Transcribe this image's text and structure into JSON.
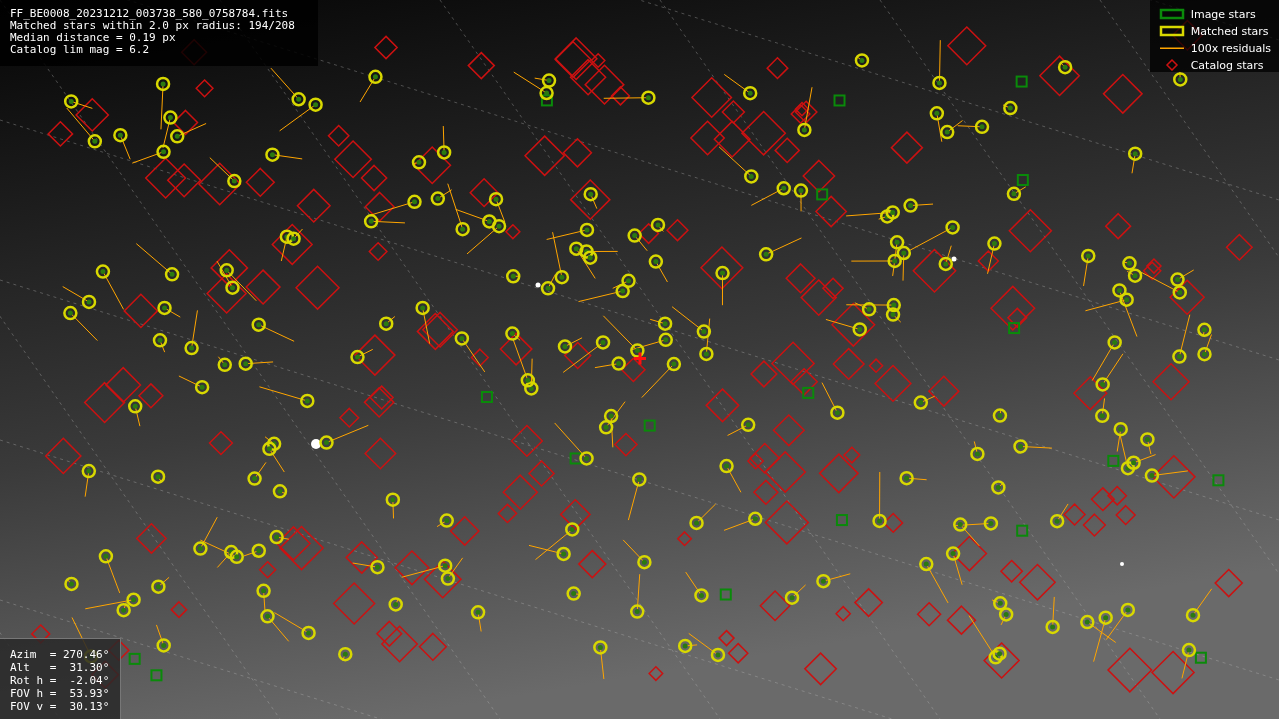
{
  "info_lines": [
    "FF_BE0008_20231212_003738_580_0758784.fits",
    "Matched stars within 2.0 px radius: 194/208",
    "Median distance = 0.19 px",
    "Catalog lim mag = 6.2"
  ],
  "legend": [
    {
      "kind": "image",
      "label": "Image stars"
    },
    {
      "kind": "matched",
      "label": "Matched stars"
    },
    {
      "kind": "residual",
      "label": "100x residuals"
    },
    {
      "kind": "catalog",
      "label": "Catalog stars"
    }
  ],
  "pointing_lines": [
    "Azim  = 270.46°",
    "Alt   =  31.30°",
    "Rot h =  -2.04°",
    "FOV h =  53.93°",
    "FOV v =  30.13°"
  ]
}
